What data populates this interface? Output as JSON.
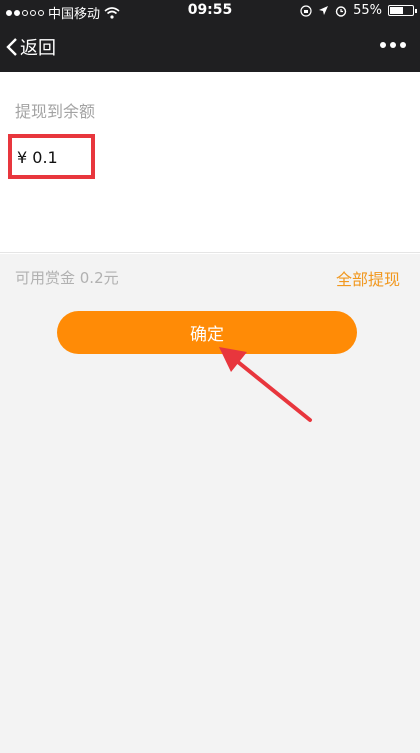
{
  "status_bar": {
    "carrier": "中国移动",
    "time": "09:55",
    "battery": "55%"
  },
  "nav": {
    "back_label": "返回"
  },
  "withdraw": {
    "section_label": "提现到余额",
    "amount": "¥ 0.1",
    "available": "可用赏金 0.2元",
    "withdraw_all": "全部提现"
  },
  "confirm_label": "确定",
  "colors": {
    "nav_bg": "#1f1f21",
    "accent": "#ff8b06",
    "link": "#f1981f",
    "highlight": "#e8363d"
  }
}
